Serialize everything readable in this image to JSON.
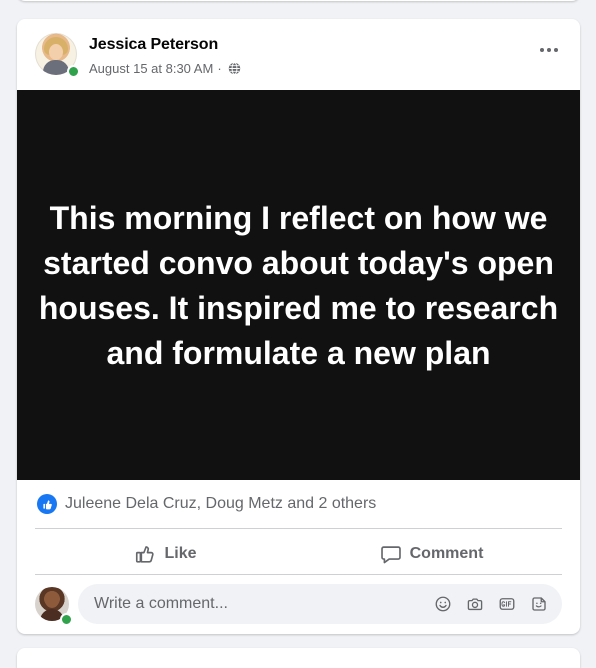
{
  "post": {
    "author": "Jessica Peterson",
    "timestamp": "August 15 at 8:30 AM",
    "separator": "·",
    "privacy_icon": "globe-icon",
    "text": "This morning I reflect on how we started convo about today's open houses. It inspired me to research and formulate a new plan",
    "reactions_text": "Juleene Dela Cruz, Doug Metz and 2 others",
    "actions": {
      "like": "Like",
      "comment": "Comment"
    },
    "comment_placeholder": "Write a comment..."
  },
  "colors": {
    "accent": "#1877f2",
    "online": "#31a24c",
    "post_background": "#111111",
    "page_background": "#f0f2f5"
  },
  "icons": {
    "more": "more-horizontal-icon",
    "like": "thumbs-up-icon",
    "comment": "comment-icon",
    "emoji": "emoji-icon",
    "camera": "camera-icon",
    "gif": "gif-icon",
    "sticker": "sticker-icon"
  }
}
